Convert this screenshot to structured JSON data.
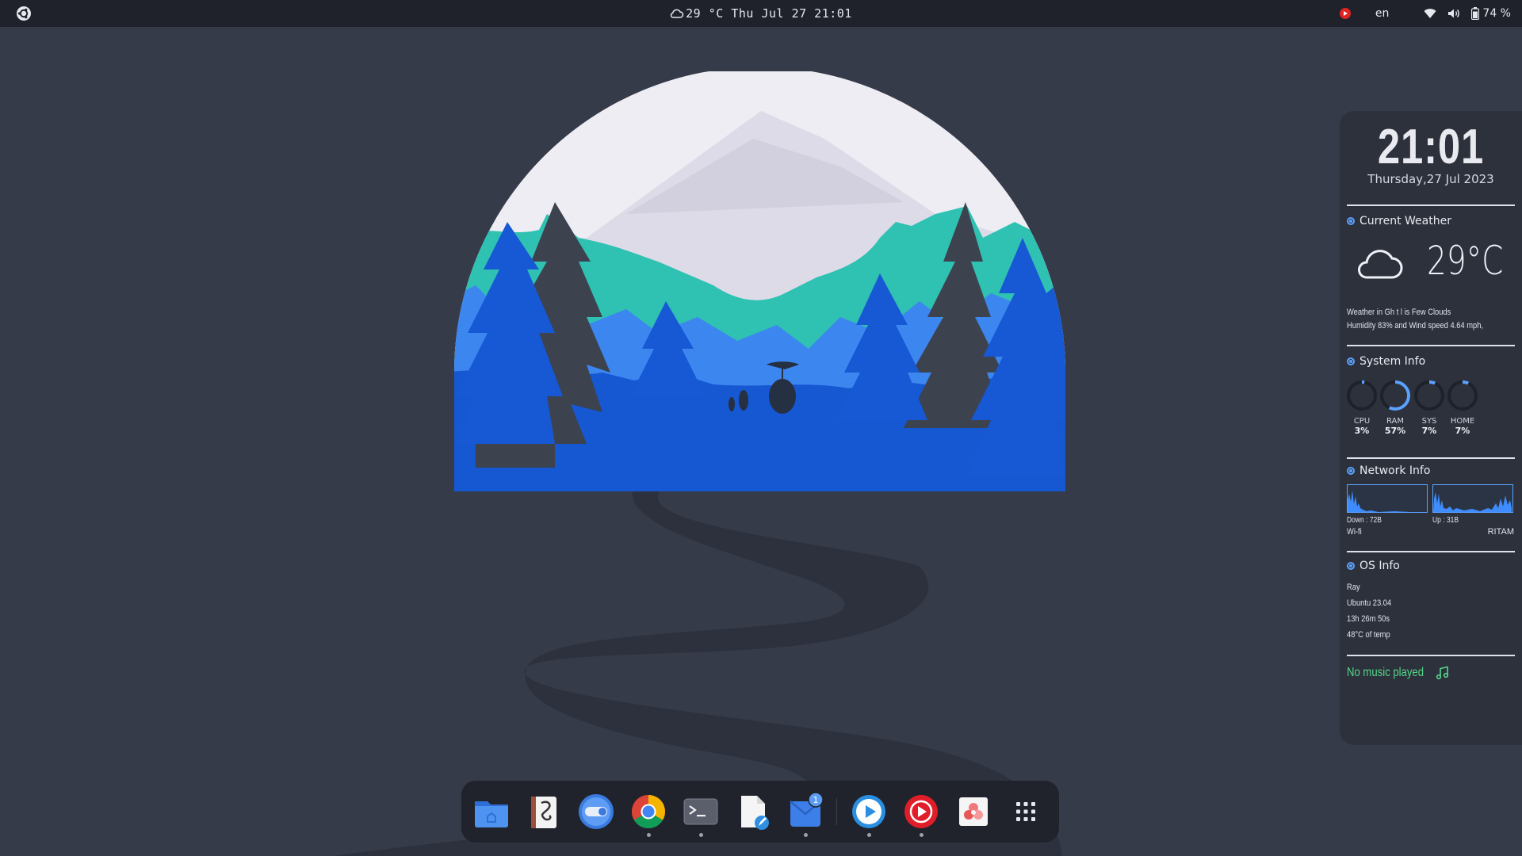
{
  "topbar": {
    "weather_icon": "cloud-icon",
    "center_text": "29 °C Thu Jul 27 21:01",
    "language": "en",
    "battery": "74 %",
    "icons": [
      "record-icon",
      "wifi-icon",
      "volume-icon",
      "battery-icon"
    ],
    "left_icon": "ubuntu-logo-icon"
  },
  "widget": {
    "clock": "21:01",
    "date": "Thursday,27 Jul 2023",
    "weather": {
      "title": "Current Weather",
      "temp": "29°C",
      "icon": "cloud-icon",
      "line1": "Weather in Gh t l is Few Clouds",
      "line2": "Humidity 83% and Wind speed 4.64 mph,"
    },
    "system": {
      "title": "System Info",
      "rings": [
        {
          "label": "CPU",
          "value": "3%",
          "fraction": 0.03
        },
        {
          "label": "RAM",
          "value": "57%",
          "fraction": 0.57
        },
        {
          "label": "SYS",
          "value": "7%",
          "fraction": 0.07
        },
        {
          "label": "HOME",
          "value": "7%",
          "fraction": 0.07
        }
      ]
    },
    "network": {
      "title": "Network Info",
      "down": "Down : 72B",
      "up": "Up : 31B",
      "interface": "Wi-fi",
      "ssid": "RITAM"
    },
    "os": {
      "title": "OS Info",
      "user": "Ray",
      "distro": "Ubuntu 23.04",
      "uptime": "13h 26m 50s",
      "temp": "48°C of temp"
    },
    "music": "No music played"
  },
  "dock": {
    "items": [
      {
        "name": "files-app-icon",
        "running": false
      },
      {
        "name": "notes-app-icon",
        "running": false
      },
      {
        "name": "settings-toggle-icon",
        "running": false
      },
      {
        "name": "chrome-browser-icon",
        "running": true
      },
      {
        "name": "terminal-icon",
        "running": true
      },
      {
        "name": "text-editor-icon",
        "running": false
      },
      {
        "name": "mail-app-icon",
        "running": true,
        "badge": "1"
      },
      {
        "name": "media-player-icon",
        "running": true
      },
      {
        "name": "youtube-music-icon",
        "running": true
      },
      {
        "name": "photo-app-icon",
        "running": false
      },
      {
        "name": "show-apps-grid-icon",
        "running": false
      }
    ]
  },
  "colors": {
    "background": "#363b4a",
    "topbar": "#1f222b",
    "accent_blue": "#5aa2ff",
    "teal": "#2fc1b2",
    "music_green": "#55d58a"
  }
}
